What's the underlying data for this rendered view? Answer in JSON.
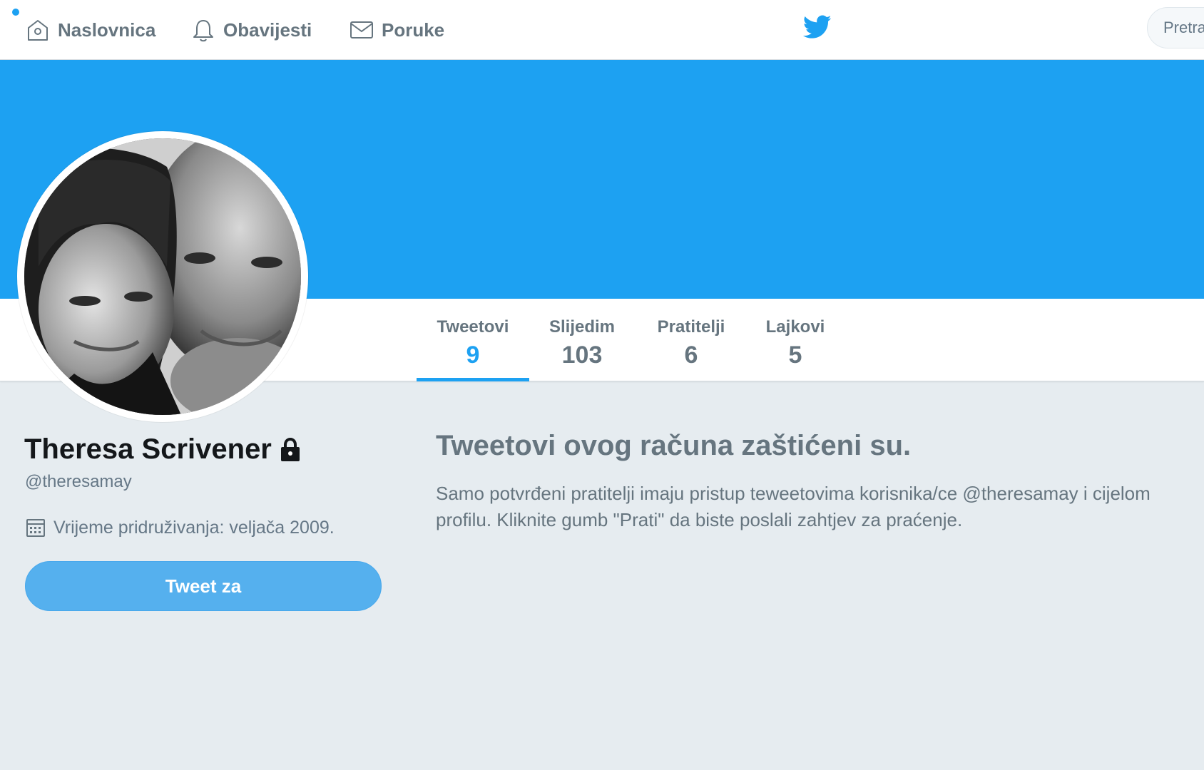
{
  "nav": {
    "home_label": "Naslovnica",
    "notifications_label": "Obavijesti",
    "messages_label": "Poruke",
    "search_placeholder": "Pretra"
  },
  "profile": {
    "name": "Theresa Scrivener",
    "handle": "@theresamay",
    "joined": "Vrijeme pridruživanja: veljača 2009.",
    "tweet_to_label": "Tweet za"
  },
  "stats": [
    {
      "label": "Tweetovi",
      "value": "9"
    },
    {
      "label": "Slijedim",
      "value": "103"
    },
    {
      "label": "Pratitelji",
      "value": "6"
    },
    {
      "label": "Lajkovi",
      "value": "5"
    }
  ],
  "protected": {
    "title": "Tweetovi ovog računa zaštićeni su.",
    "text": "Samo potvrđeni pratitelji imaju pristup teweetovima korisnika/ce @theresamay i cijelom profilu. Kliknite gumb \"Prati\" da biste poslali zahtjev za praćenje."
  },
  "colors": {
    "brand": "#1da1f2",
    "background": "#e6ecf0",
    "muted_text": "#66757f",
    "button": "#55b0ee"
  },
  "icons": {
    "home": "home-icon",
    "notifications": "bell-icon",
    "messages": "envelope-icon",
    "logo": "twitter-bird-icon",
    "lock": "lock-icon",
    "calendar": "calendar-icon"
  }
}
